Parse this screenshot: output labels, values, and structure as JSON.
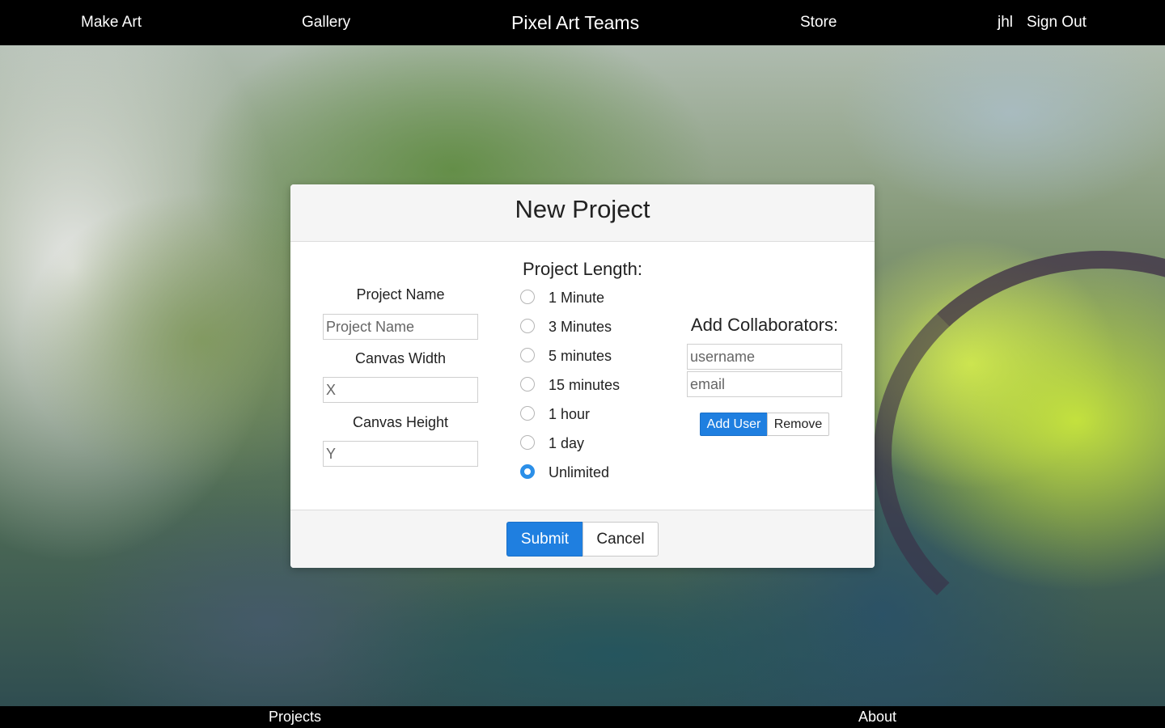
{
  "topnav": {
    "make_art": "Make Art",
    "gallery": "Gallery",
    "brand": "Pixel Art Teams",
    "store": "Store",
    "username": "jhl",
    "sign_out": "Sign Out"
  },
  "bottomnav": {
    "projects": "Projects",
    "about": "About"
  },
  "modal": {
    "title": "New Project",
    "project_name_label": "Project Name",
    "project_name_placeholder": "Project Name",
    "canvas_width_label": "Canvas Width",
    "canvas_width_placeholder": "X",
    "canvas_height_label": "Canvas Height",
    "canvas_height_placeholder": "Y",
    "project_length_label": "Project Length:",
    "length_options": [
      "1 Minute",
      "3 Minutes",
      "5 minutes",
      "15 minutes",
      "1 hour",
      "1 day",
      "Unlimited"
    ],
    "selected_length": "Unlimited",
    "collaborators_label": "Add Collaborators:",
    "username_placeholder": "username",
    "email_placeholder": "email",
    "add_user_label": "Add User",
    "remove_label": "Remove",
    "submit_label": "Submit",
    "cancel_label": "Cancel"
  },
  "colors": {
    "primary": "#1f7fe0",
    "radio_checked": "#2b8fe8",
    "nav_bg": "#000000"
  }
}
